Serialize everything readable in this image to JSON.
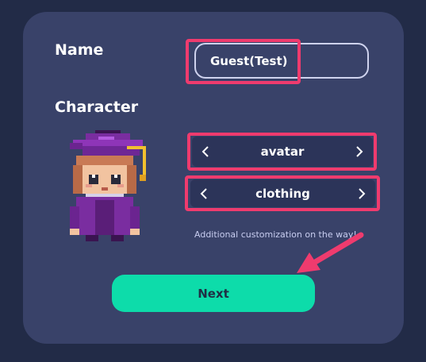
{
  "form": {
    "name_label": "Name",
    "name_value": "Guest(Test)",
    "character_label": "Character",
    "avatar_value": "avatar",
    "clothing_value": "clothing",
    "note": "Additional customization on the way!",
    "next_label": "Next"
  },
  "icons": {
    "prev": "chevron-left-icon",
    "next": "chevron-right-icon",
    "annotation": "arrow-pointer-icon"
  },
  "colors": {
    "background": "#222b47",
    "card": "#394269",
    "highlight": "#ef3b6e",
    "primary_button": "#0ddcaa"
  }
}
